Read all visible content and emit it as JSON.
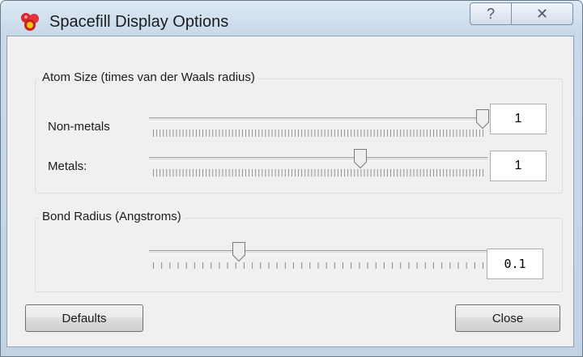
{
  "window": {
    "title": "Spacefill Display Options",
    "help_glyph": "?",
    "close_glyph": "✕"
  },
  "atom_size": {
    "group_title": "Atom Size (times van der Waals radius)",
    "nonmetals": {
      "label": "Non-metals",
      "value": "1",
      "slider_fraction": 1.0
    },
    "metals": {
      "label": "Metals:",
      "value": "1",
      "slider_fraction": 0.63
    }
  },
  "bond_radius": {
    "group_title": "Bond Radius (Angstroms)",
    "value": "0.1",
    "slider_fraction": 0.26
  },
  "buttons": {
    "defaults": "Defaults",
    "close": "Close"
  },
  "icons": {
    "app": "spacefill-molecule-icon",
    "help": "help-icon",
    "close": "close-icon"
  }
}
